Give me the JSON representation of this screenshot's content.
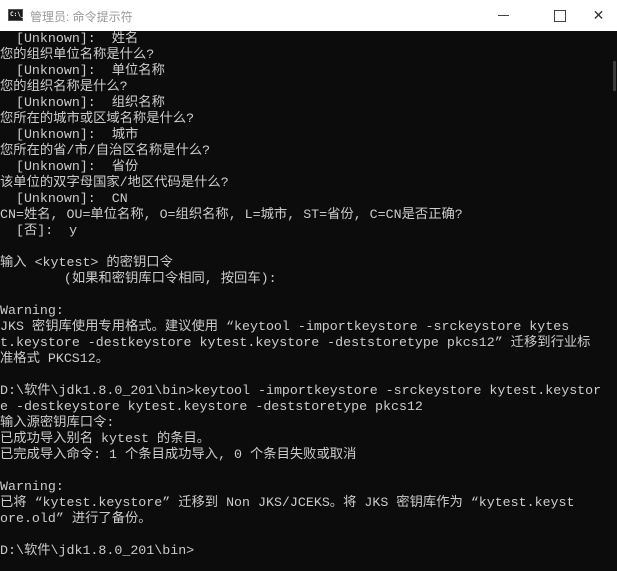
{
  "window": {
    "title": "管理员: 命令提示符",
    "icon_label": "C:\\_",
    "minimize_icon": "minimize-icon",
    "maximize_icon": "maximize-icon",
    "close_icon": "close-icon",
    "close_glyph": "✕"
  },
  "console": {
    "lines": [
      "  [Unknown]:  姓名",
      "您的组织单位名称是什么?",
      "  [Unknown]:  单位名称",
      "您的组织名称是什么?",
      "  [Unknown]:  组织名称",
      "您所在的城市或区域名称是什么?",
      "  [Unknown]:  城市",
      "您所在的省/市/自治区名称是什么?",
      "  [Unknown]:  省份",
      "该单位的双字母国家/地区代码是什么?",
      "  [Unknown]:  CN",
      "CN=姓名, OU=单位名称, O=组织名称, L=城市, ST=省份, C=CN是否正确?",
      "  [否]:  y",
      "",
      "输入 <kytest> 的密钥口令",
      "        (如果和密钥库口令相同, 按回车):",
      "",
      "Warning:",
      "JKS 密钥库使用专用格式。建议使用 “keytool -importkeystore -srckeystore kytes",
      "t.keystore -destkeystore kytest.keystore -deststoretype pkcs12” 迁移到行业标",
      "准格式 PKCS12。",
      "",
      "D:\\软件\\jdk1.8.0_201\\bin>keytool -importkeystore -srckeystore kytest.keystor",
      "e -destkeystore kytest.keystore -deststoretype pkcs12",
      "输入源密钥库口令:",
      "已成功导入别名 kytest 的条目。",
      "已完成导入命令: 1 个条目成功导入, 0 个条目失败或取消",
      "",
      "Warning:",
      "已将 “kytest.keystore” 迁移到 Non JKS/JCEKS。将 JKS 密钥库作为 “kytest.keyst",
      "ore.old” 进行了备份。",
      "",
      "D:\\软件\\jdk1.8.0_201\\bin>"
    ]
  },
  "colors": {
    "background": "#0c0c0c",
    "text": "#cccccc",
    "titlebar": "#ffffff"
  }
}
